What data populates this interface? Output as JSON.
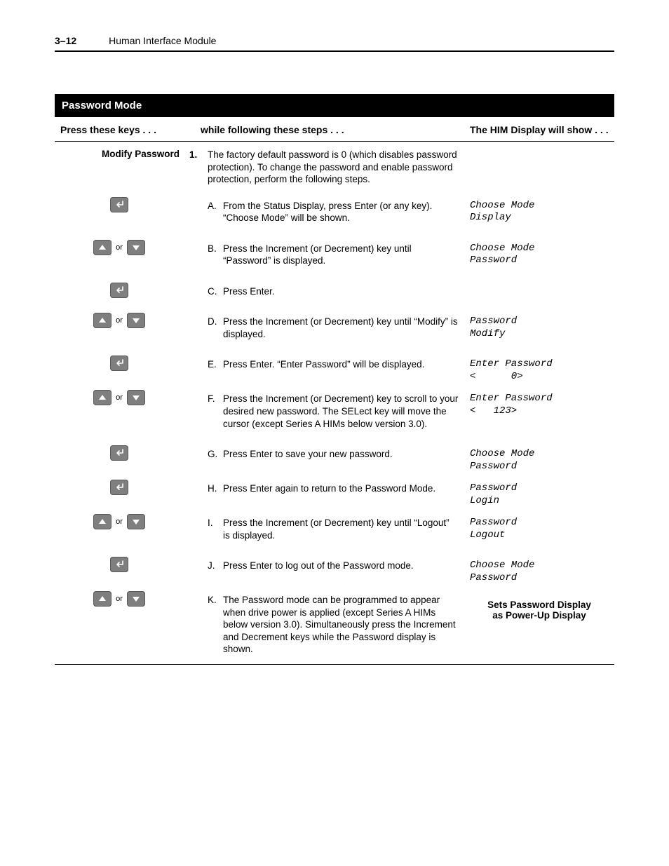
{
  "header": {
    "page_number": "3–12",
    "chapter": "Human Interface Module"
  },
  "section_title": "Password Mode",
  "columns": {
    "c1": "Press these keys . . .",
    "c2": "while following these steps . . .",
    "c3": "The HIM Display will show . . ."
  },
  "procedure_title": "Modify Password",
  "intro_marker": "1.",
  "intro_text": "The factory default password is 0 (which disables password protection). To change the password and enable password protection, perform the following steps.",
  "or_label": "or",
  "steps": [
    {
      "marker": "A.",
      "text": "From the Status Display, press Enter (or any key). “Choose Mode” will be shown.",
      "keys": "enter",
      "display": [
        "Choose Mode",
        "Display"
      ]
    },
    {
      "marker": "B.",
      "text": "Press the Increment (or Decrement) key until “Password” is displayed.",
      "keys": "updown",
      "display": [
        "Choose Mode",
        "Password"
      ]
    },
    {
      "marker": "C.",
      "text": "Press Enter.",
      "keys": "enter",
      "display": []
    },
    {
      "marker": "D.",
      "text": "Press the Increment (or Decrement) key until “Modify” is displayed.",
      "keys": "updown",
      "display": [
        "Password",
        "Modify"
      ]
    },
    {
      "marker": "E.",
      "text": "Press Enter. “Enter Password” will be displayed.",
      "keys": "enter",
      "display": [
        "Enter Password",
        "<      0>"
      ]
    },
    {
      "marker": "F.",
      "text": "Press the Increment (or Decrement) key to scroll to your desired new password. The SELect key will move the cursor (except Series A HIMs below version 3.0).",
      "keys": "updown",
      "display": [
        "Enter Password",
        "<   123>"
      ]
    },
    {
      "marker": "G.",
      "text": "Press Enter to save your new password.",
      "keys": "enter",
      "display": [
        "Choose Mode",
        "Password"
      ]
    },
    {
      "marker": "H.",
      "text": "Press Enter again to return to the Password Mode.",
      "keys": "enter",
      "display": [
        "Password",
        "Login"
      ]
    },
    {
      "marker": "I.",
      "text": "Press the Increment (or Decrement) key until “Logout” is displayed.",
      "keys": "updown",
      "display": [
        "Password",
        "Logout"
      ]
    },
    {
      "marker": "J.",
      "text": "Press Enter to log out of the Password mode.",
      "keys": "enter",
      "display": [
        "Choose Mode",
        "Password"
      ]
    },
    {
      "marker": "K.",
      "text": "The Password mode can be programmed to appear when drive power is applied (except Series A HIMs below version 3.0). Simultaneously press the Increment and Decrement keys while the Password display is shown.",
      "keys": "updown",
      "display_bold": [
        "Sets Password Display",
        "as Power-Up Display"
      ]
    }
  ]
}
